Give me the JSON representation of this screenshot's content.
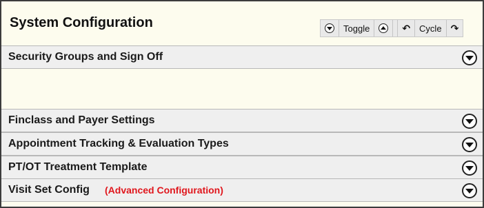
{
  "header": {
    "title": "System Configuration",
    "toolbar": {
      "toggle_label": "Toggle",
      "cycle_label": "Cycle"
    }
  },
  "sections": [
    {
      "title": "Security Groups and Sign Off",
      "note": ""
    },
    {
      "title": "Finclass and Payer Settings",
      "note": ""
    },
    {
      "title": "Appointment Tracking & Evaluation Types",
      "note": ""
    },
    {
      "title": "PT/OT Treatment Template",
      "note": ""
    },
    {
      "title": "Visit Set Config",
      "note": "(Advanced Configuration)"
    }
  ],
  "icons": {
    "expand": "chevron-down-circle-icon",
    "collapse_all": "chevron-down-circle-icon",
    "expand_all": "chevron-up-circle-icon",
    "cycle_back": "undo-arrow-icon",
    "cycle_forward": "redo-arrow-icon"
  },
  "colors": {
    "background": "#fdfcee",
    "section_header": "#efefef",
    "note_red": "#e0161c"
  }
}
